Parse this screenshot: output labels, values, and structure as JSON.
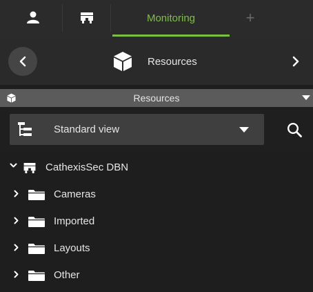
{
  "tabs": {
    "user_icon": "user-icon",
    "station_icon": "station-icon",
    "active_tab_label": "Monitoring",
    "add_tab_label": "+"
  },
  "nav": {
    "title": "Resources",
    "title_icon": "cube-icon"
  },
  "section": {
    "label": "Resources"
  },
  "view_selector": {
    "selected": "Standard view"
  },
  "tree": {
    "root": {
      "label": "CathexisSec DBN",
      "expanded": true
    },
    "children": [
      {
        "label": "Cameras"
      },
      {
        "label": "Imported"
      },
      {
        "label": "Layouts"
      },
      {
        "label": "Other"
      }
    ]
  },
  "colors": {
    "accent": "#7dc142",
    "background": "#1e1e1e",
    "header_bar": "#5b5b5b"
  }
}
